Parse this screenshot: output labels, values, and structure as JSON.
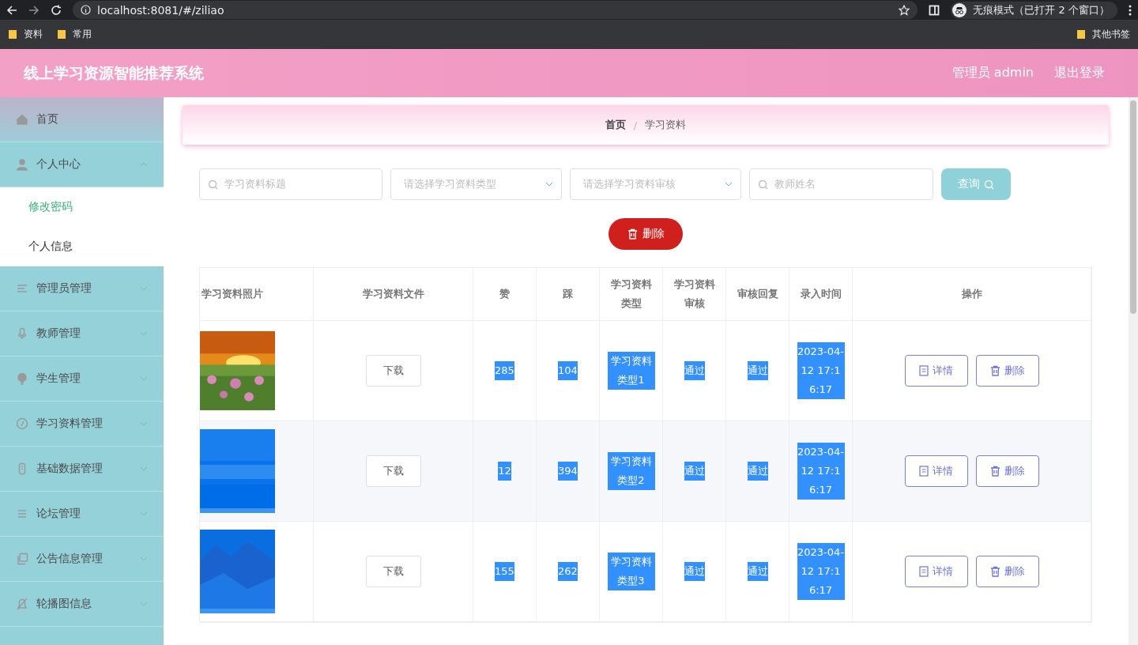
{
  "browser": {
    "url": "localhost:8081/#/ziliao",
    "incognito_label": "无痕模式（已打开 2 个窗口）",
    "bookmarks": [
      "资料",
      "常用"
    ],
    "other_bookmarks": "其他书签"
  },
  "header": {
    "title": "线上学习资源智能推荐系统",
    "user": "管理员 admin",
    "logout": "退出登录"
  },
  "sidebar": {
    "items": [
      {
        "label": "首页"
      },
      {
        "label": "个人中心",
        "expanded": true,
        "children": [
          {
            "label": "修改密码",
            "selected": true
          },
          {
            "label": "个人信息",
            "selected": false
          }
        ]
      },
      {
        "label": "管理员管理",
        "expanded": false
      },
      {
        "label": "教师管理",
        "expanded": false
      },
      {
        "label": "学生管理",
        "expanded": false
      },
      {
        "label": "学习资料管理",
        "expanded": false
      },
      {
        "label": "基础数据管理",
        "expanded": false
      },
      {
        "label": "论坛管理",
        "expanded": false
      },
      {
        "label": "公告信息管理",
        "expanded": false
      },
      {
        "label": "轮播图信息",
        "expanded": false
      }
    ]
  },
  "breadcrumb": [
    "首页",
    "学习资料"
  ],
  "breadcrumb_separator": "/",
  "filters": [
    {
      "kind": "input",
      "placeholder": "学习资料标题"
    },
    {
      "kind": "select",
      "placeholder": "请选择学习资料类型"
    },
    {
      "kind": "select",
      "placeholder": "请选择学习资料审核"
    },
    {
      "kind": "input",
      "placeholder": "教师姓名"
    }
  ],
  "search_button": "查询",
  "delete_button": "删除",
  "table": {
    "columns": [
      "学习资料照片",
      "学习资料文件",
      "赞",
      "踩",
      "学习资料类型",
      "学习资料审核",
      "审核回复",
      "录入时间",
      "操作"
    ],
    "rows": [
      {
        "picture": {
          "kind": "picture"
        },
        "file_button": "下载",
        "likes": "285",
        "dislikes": "104",
        "type": "学习资料类型1",
        "review": "通过",
        "reply": "通过",
        "time": "2023-04-12 17:16:17",
        "actions": [
          "详情",
          "删除"
        ],
        "highlighted": true
      },
      {
        "picture": {
          "kind": "picture"
        },
        "file_button": "下载",
        "likes": "12",
        "dislikes": "394",
        "type": "学习资料类型2",
        "review": "通过",
        "reply": "通过",
        "time": "2023-04-12 17:16:17",
        "actions": [
          "详情",
          "删除"
        ],
        "highlighted": true
      },
      {
        "picture": {
          "kind": "picture"
        },
        "file_button": "下载",
        "likes": "155",
        "dislikes": "262",
        "type": "学习资料类型3",
        "review": "通过",
        "reply": "通过",
        "time": "2023-04-12 17:16:17",
        "actions": [
          "详情",
          "删除"
        ],
        "highlighted": true
      }
    ]
  }
}
